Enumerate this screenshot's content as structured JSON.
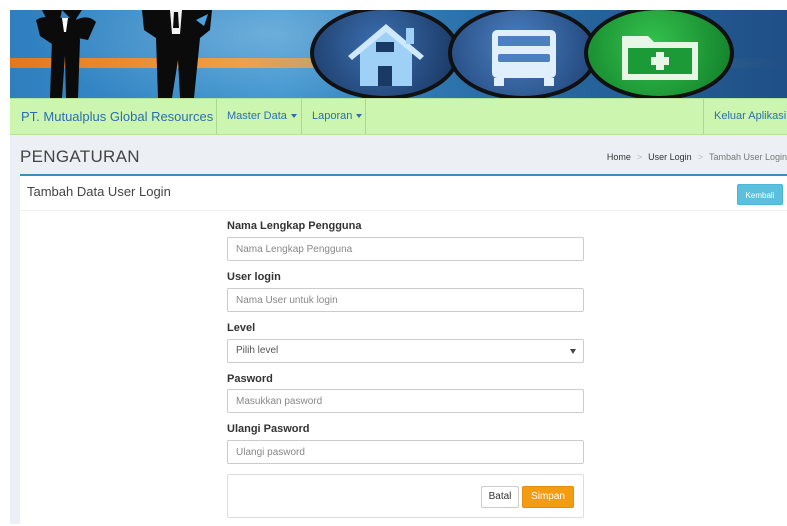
{
  "navbar": {
    "brand": "PT. Mutualplus Global Resources",
    "menu_master_data": "Master Data",
    "menu_laporan": "Laporan",
    "logout": "Keluar Aplikasi"
  },
  "page": {
    "title": "PENGATURAN",
    "breadcrumb": [
      "Home",
      "User Login",
      "Tambah User Login"
    ],
    "breadcrumb_separator": ">"
  },
  "box": {
    "title": "Tambah Data User Login",
    "back_button": "Kembali"
  },
  "form": {
    "fields": [
      {
        "label": "Nama Lengkap Pengguna",
        "placeholder": "Nama Lengkap Pengguna",
        "value": ""
      },
      {
        "label": "User login",
        "placeholder": "Nama User untuk login",
        "value": ""
      },
      {
        "label": "Level",
        "selected": "Pilih level"
      },
      {
        "label": "Pasword",
        "placeholder": "Masukkan pasword",
        "value": ""
      },
      {
        "label": "Ulangi Pasword",
        "placeholder": "Ulangi pasword",
        "value": ""
      }
    ],
    "cancel_button": "Batal",
    "save_button": "Simpan"
  },
  "colors": {
    "navbar_bg": "#ccf5b0",
    "link": "#2a6fb0",
    "box_border": "#3c8dbc",
    "info_button": "#5bc0de",
    "warning_button": "#f39c12"
  },
  "icons": {
    "banner_left": "businessmen-silhouette-icon",
    "banner_1": "house-icon",
    "banner_2": "bus-icon",
    "banner_3": "folder-add-icon"
  }
}
